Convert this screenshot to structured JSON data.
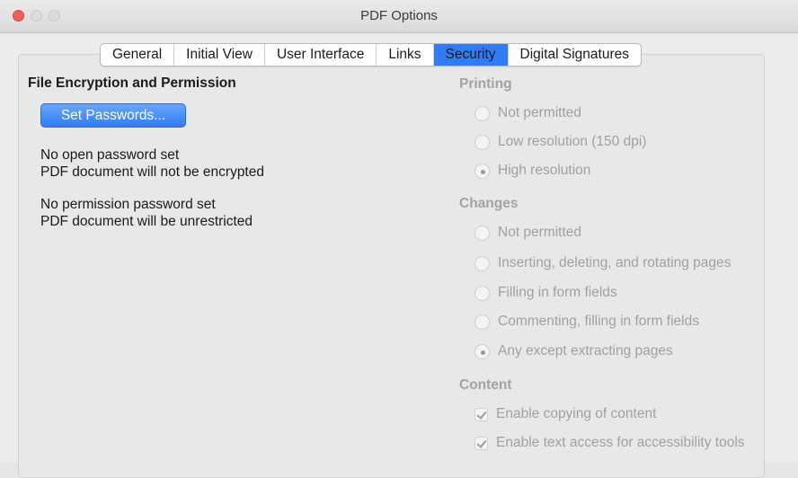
{
  "window": {
    "title": "PDF Options"
  },
  "tabs": [
    "General",
    "Initial View",
    "User Interface",
    "Links",
    "Security",
    "Digital Signatures"
  ],
  "active_tab": "Security",
  "encryption": {
    "heading": "File Encryption and Permission",
    "set_passwords_label": "Set Passwords...",
    "open_password_line1": "No open password set",
    "open_password_line2": "PDF document will not be encrypted",
    "permission_password_line1": "No permission password set",
    "permission_password_line2": "PDF document will be unrestricted"
  },
  "printing": {
    "heading": "Printing",
    "options": [
      {
        "label": "Not permitted",
        "selected": false
      },
      {
        "label": "Low resolution (150 dpi)",
        "selected": false
      },
      {
        "label": "High resolution",
        "selected": true
      }
    ]
  },
  "changes": {
    "heading": "Changes",
    "options": [
      {
        "label": "Not permitted",
        "selected": false
      },
      {
        "label": "Inserting, deleting, and rotating pages",
        "selected": false
      },
      {
        "label": "Filling in form fields",
        "selected": false
      },
      {
        "label": "Commenting, filling in form fields",
        "selected": false
      },
      {
        "label": "Any except extracting pages",
        "selected": true
      }
    ]
  },
  "content": {
    "heading": "Content",
    "options": [
      {
        "label": "Enable copying of content",
        "checked": true
      },
      {
        "label": "Enable text access for accessibility tools",
        "checked": true
      }
    ]
  },
  "colors": {
    "accent": "#2f7cf6",
    "close_light": "#ee5f57",
    "disabled_text": "#a0a0a0"
  }
}
